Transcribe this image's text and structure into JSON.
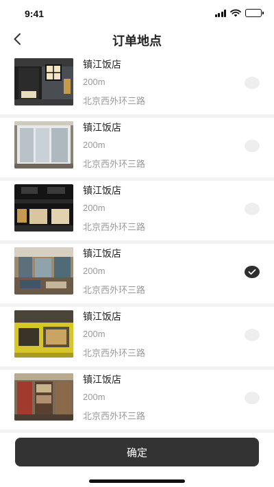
{
  "status_bar": {
    "time": "9:41"
  },
  "nav": {
    "title": "订单地点",
    "back_icon": "chevron-left-icon"
  },
  "stores": [
    {
      "name": "镇江饭店",
      "distance": "200m",
      "address": "北京西外环三路",
      "selected": false,
      "photo": "lantern-doorway"
    },
    {
      "name": "镇江饭店",
      "distance": "200m",
      "address": "北京西外环三路",
      "selected": false,
      "photo": "white-glass-storefront"
    },
    {
      "name": "镇江饭店",
      "distance": "200m",
      "address": "北京西外环三路",
      "selected": false,
      "photo": "dark-night-storefront"
    },
    {
      "name": "镇江饭店",
      "distance": "200m",
      "address": "北京西外环三路",
      "selected": true,
      "photo": "restaurant-interior"
    },
    {
      "name": "镇江饭店",
      "distance": "200m",
      "address": "北京西外环三路",
      "selected": false,
      "photo": "yellow-shop-front"
    },
    {
      "name": "镇江饭店",
      "distance": "200m",
      "address": "北京西外环三路",
      "selected": false,
      "photo": "bookstore-shelves"
    }
  ],
  "confirm_button": {
    "label": "确定"
  },
  "colors": {
    "button_bg": "#333333",
    "checked_radio": "#2e2e2e",
    "unchecked_radio": "#eeeeee",
    "secondary_text": "#9a9a9a"
  }
}
